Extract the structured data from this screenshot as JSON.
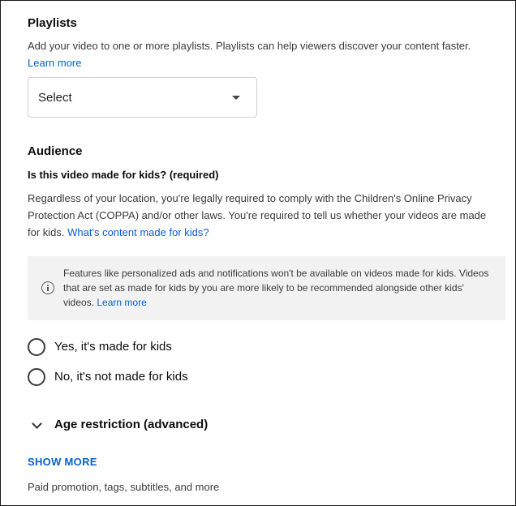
{
  "playlists": {
    "title": "Playlists",
    "description": "Add your video to one or more playlists. Playlists can help viewers discover your content faster.",
    "learn_more": "Learn more",
    "select_value": "Select"
  },
  "audience": {
    "title": "Audience",
    "question": "Is this video made for kids? (required)",
    "description": "Regardless of your location, you're legally required to comply with the Children's Online Privacy Protection Act (COPPA) and/or other laws. You're required to tell us whether your videos are made for kids.",
    "link": "What's content made for kids?",
    "info": {
      "text": "Features like personalized ads and notifications won't be available on videos made for kids. Videos that are set as made for kids by you are more likely to be recommended alongside other kids' videos.",
      "learn_more": "Learn more"
    },
    "options": [
      {
        "label": "Yes, it's made for kids"
      },
      {
        "label": "No, it's not made for kids"
      }
    ]
  },
  "age_restriction": {
    "label": "Age restriction (advanced)"
  },
  "show_more": {
    "label": "SHOW MORE",
    "subtitle": "Paid promotion, tags, subtitles, and more"
  },
  "colors": {
    "link": "#065fd4",
    "info_background": "#f2f2f2"
  }
}
